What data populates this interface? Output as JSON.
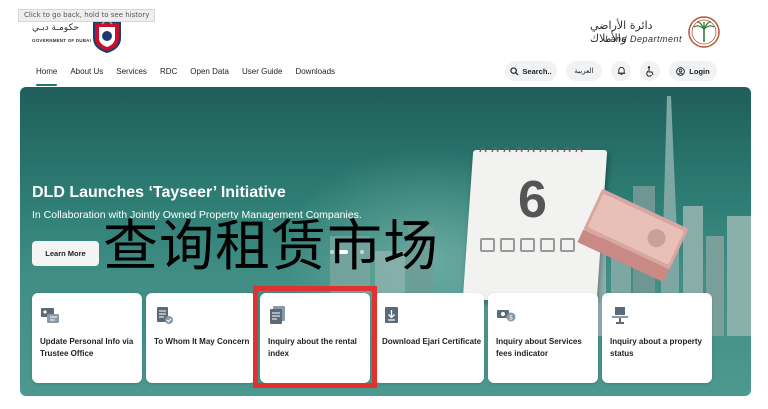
{
  "tooltip": "Click to go back, hold to see history",
  "logos": {
    "gov_arabic": "حكومـة دبـي",
    "gov_english": "GOVERNMENT OF DUBAI",
    "dld_arabic": "دائرة الأراضي والأملاك",
    "dld_english": "Land Department"
  },
  "nav": {
    "items": [
      {
        "label": "Home",
        "active": true
      },
      {
        "label": "About Us"
      },
      {
        "label": "Services"
      },
      {
        "label": "RDC"
      },
      {
        "label": "Open Data"
      },
      {
        "label": "User Guide"
      },
      {
        "label": "Downloads"
      }
    ],
    "search_label": "Search..",
    "language_label": "العربية",
    "login_label": "Login"
  },
  "hero": {
    "title": "DLD Launches ‘Tayseer’ Initiative",
    "subtitle": "In Collaboration with Jointly Owned Property Management Companies.",
    "button_label": "Learn More",
    "calendar_number": "6"
  },
  "overlay_text": "查询租赁市场",
  "cards": [
    {
      "label": "Update Personal Info via Trustee Office",
      "icon": "id-card-icon"
    },
    {
      "label": "To Whom It May Concern",
      "icon": "document-check-icon"
    },
    {
      "label": "Inquiry about the rental index",
      "icon": "document-list-icon"
    },
    {
      "label": "Download Ejari Certificate",
      "icon": "download-document-icon"
    },
    {
      "label": "Inquiry about Services fees indicator",
      "icon": "money-icon"
    },
    {
      "label": "Inquiry about a property status",
      "icon": "property-status-icon"
    }
  ],
  "colors": {
    "accent": "#1a7a5e",
    "highlight": "#e0322f",
    "hero_teal": "#2d7c73"
  }
}
